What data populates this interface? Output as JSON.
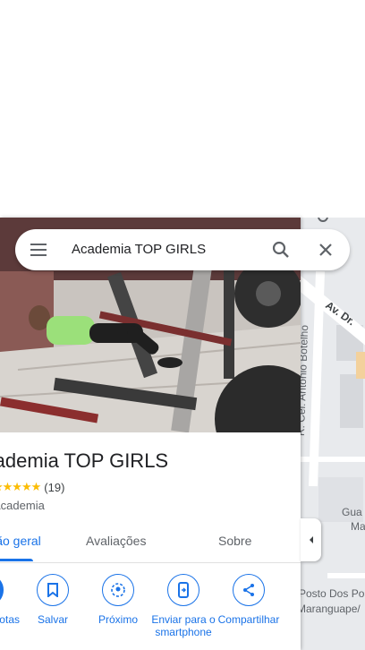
{
  "search": {
    "query": "Academia TOP GIRLS"
  },
  "place": {
    "name": "Academia TOP GIRLS",
    "stars": "★★★★★",
    "reviews_count": "(19)",
    "category": "Academia"
  },
  "tabs": [
    {
      "label": "Visão geral",
      "active": true
    },
    {
      "label": "Avaliações",
      "active": false
    },
    {
      "label": "Sobre",
      "active": false
    }
  ],
  "actions": [
    {
      "label": "Rotas"
    },
    {
      "label": "Salvar"
    },
    {
      "label": "Próximo"
    },
    {
      "label": "Enviar para o smartphone"
    },
    {
      "label": "Compartilhar"
    }
  ],
  "map": {
    "street_1": "R. Cel. Antônio Botelho",
    "street_2": "Av. Dr.",
    "place_1": "Gua",
    "place_2": "Ma",
    "place_3": "Posto Dos Pobres",
    "place_4": "Maranguape/"
  },
  "colors": {
    "accent": "#1a73e8",
    "star": "#fbbc04",
    "map_bg": "#e8eaed"
  }
}
